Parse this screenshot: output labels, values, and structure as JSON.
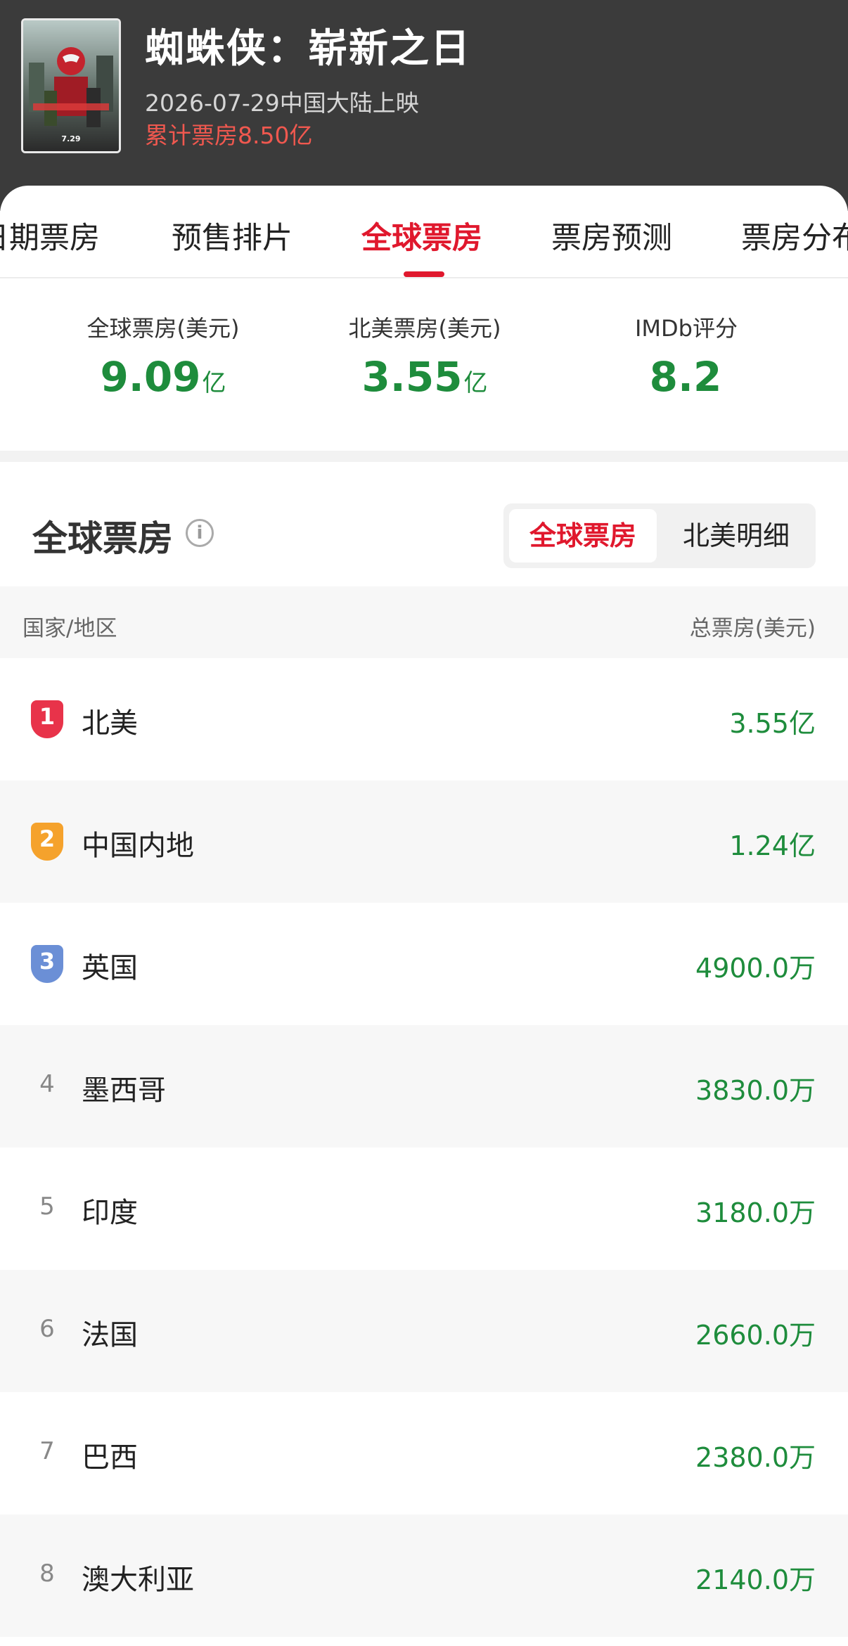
{
  "movie": {
    "title": "蜘蛛侠：崭新之日",
    "release": "2026-07-29中国大陆上映",
    "total_box": "累计票房8.50亿",
    "poster_date": "7.29"
  },
  "tabs": [
    "日期票房",
    "预售排片",
    "全球票房",
    "票房预测",
    "票房分布"
  ],
  "active_tab": "全球票房",
  "stats": [
    {
      "label": "全球票房(美元)",
      "value": "9.09",
      "unit": "亿"
    },
    {
      "label": "北美票房(美元)",
      "value": "3.55",
      "unit": "亿"
    },
    {
      "label": "IMDb评分",
      "value": "8.2",
      "unit": ""
    }
  ],
  "section": {
    "title": "全球票房",
    "info_icon": "i",
    "segments": [
      "全球票房",
      "北美明细"
    ]
  },
  "table": {
    "col_region": "国家/地区",
    "col_total": "总票房(美元)",
    "rows": [
      {
        "rank": "1",
        "country": "北美",
        "amount": "3.55亿"
      },
      {
        "rank": "2",
        "country": "中国内地",
        "amount": "1.24亿"
      },
      {
        "rank": "3",
        "country": "英国",
        "amount": "4900.0万"
      },
      {
        "rank": "4",
        "country": "墨西哥",
        "amount": "3830.0万"
      },
      {
        "rank": "5",
        "country": "印度",
        "amount": "3180.0万"
      },
      {
        "rank": "6",
        "country": "法国",
        "amount": "2660.0万"
      },
      {
        "rank": "7",
        "country": "巴西",
        "amount": "2380.0万"
      },
      {
        "rank": "8",
        "country": "澳大利亚",
        "amount": "2140.0万"
      }
    ]
  },
  "colors": {
    "accent": "#e0182d",
    "value_green": "#1e8c3c",
    "rank1": "#e8334a",
    "rank2": "#f5a22c",
    "rank3": "#6b8fd6"
  }
}
